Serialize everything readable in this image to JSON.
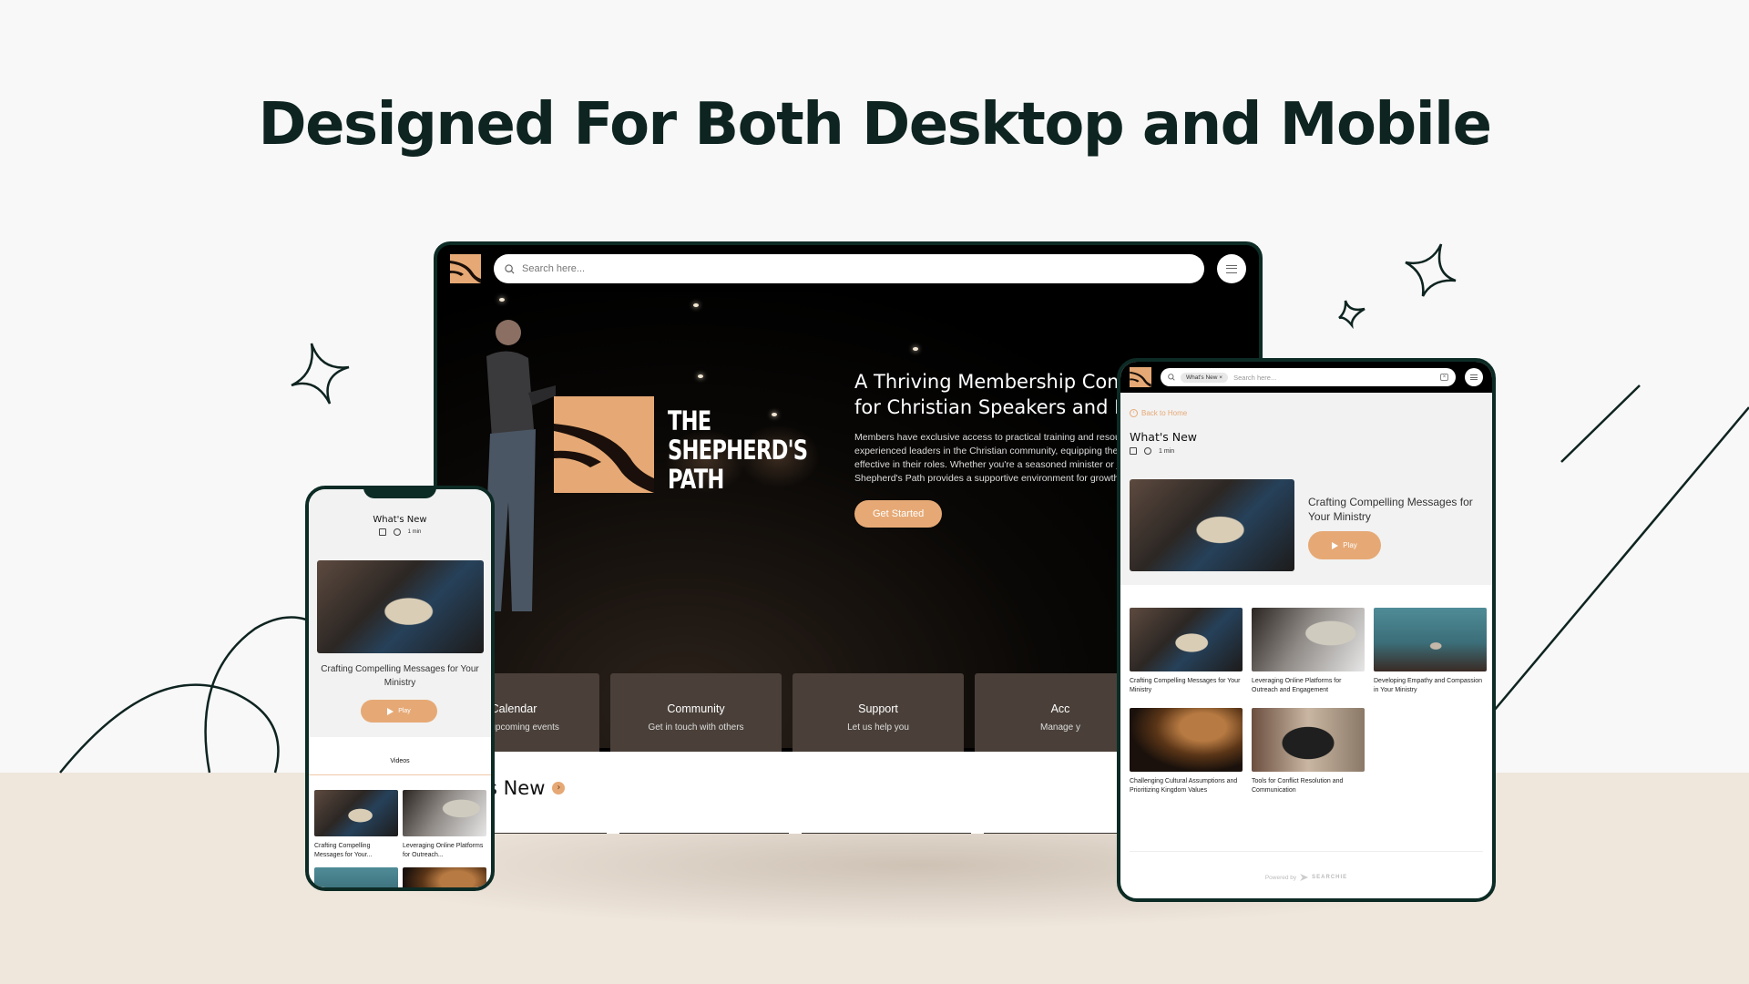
{
  "headline": "Designed For Both Desktop and Mobile",
  "colors": {
    "accent": "#e6a975",
    "dark_frame": "#0d2b25",
    "card_bg": "#4a4039",
    "floor": "#efe6dc",
    "page_bg": "#f8f8f8"
  },
  "desktop": {
    "search": {
      "placeholder": "Search here...",
      "icon": "search-icon"
    },
    "menu_icon": "hamburger-menu-icon",
    "brand": {
      "line1": "THE",
      "line2": "SHEPHERD'S",
      "line3": "PATH"
    },
    "hero": {
      "title_line1": "A Thriving Membership Comm",
      "title_line2": "for Christian Speakers and Pas",
      "body_lines": [
        "Members have exclusive access to practical training and resources f",
        "experienced leaders in the Christian community, equipping them to",
        "effective in their roles. Whether you're a seasoned minister or just s",
        "Shepherd's Path provides a supportive environment for growth and"
      ],
      "cta_label": "Get Started"
    },
    "cards": [
      {
        "title": "Calendar",
        "subtitle": "View upcoming events"
      },
      {
        "title": "Community",
        "subtitle": "Get in touch with others"
      },
      {
        "title": "Support",
        "subtitle": "Let us help you"
      },
      {
        "title": "Acc",
        "subtitle": "Manage y"
      }
    ],
    "whats_new": {
      "title": "What's New",
      "arrow": "›"
    }
  },
  "tablet": {
    "search": {
      "chip": "What's New",
      "chip_close": "×",
      "placeholder": "Search here..."
    },
    "back_label": "Back to Home",
    "title": "What's New",
    "meta_duration": "1 min",
    "featured": {
      "title": "Crafting Compelling Messages for Your Ministry",
      "play_label": "Play"
    },
    "items": [
      {
        "caption": "Crafting Compelling Messages for Your Ministry",
        "image": "img-bible"
      },
      {
        "caption": "Leveraging Online Platforms for Outreach and Engagement",
        "image": "img-laptop"
      },
      {
        "caption": "Developing Empathy and Compassion in Your Ministry",
        "image": "img-worship"
      },
      {
        "caption": "Challenging Cultural Assumptions and Prioritizing Kingdom Values",
        "image": "img-dome"
      },
      {
        "caption": "Tools for Conflict Resolution and Communication",
        "image": "img-coffee"
      }
    ],
    "powered_by": "Powered by",
    "powered_brand": "SEARCHIE"
  },
  "phone": {
    "title": "What's New",
    "meta_duration": "1 min",
    "featured": {
      "title": "Crafting Compelling Messages for Your Ministry",
      "play_label": "Play"
    },
    "tab_label": "Videos",
    "items": [
      {
        "caption": "Crafting Compelling Messages for Your...",
        "image": "img-bible"
      },
      {
        "caption": "Leveraging Online Platforms for Outreach...",
        "image": "img-laptop"
      },
      {
        "caption": "",
        "image": "img-worship"
      },
      {
        "caption": "",
        "image": "img-dome"
      }
    ]
  }
}
